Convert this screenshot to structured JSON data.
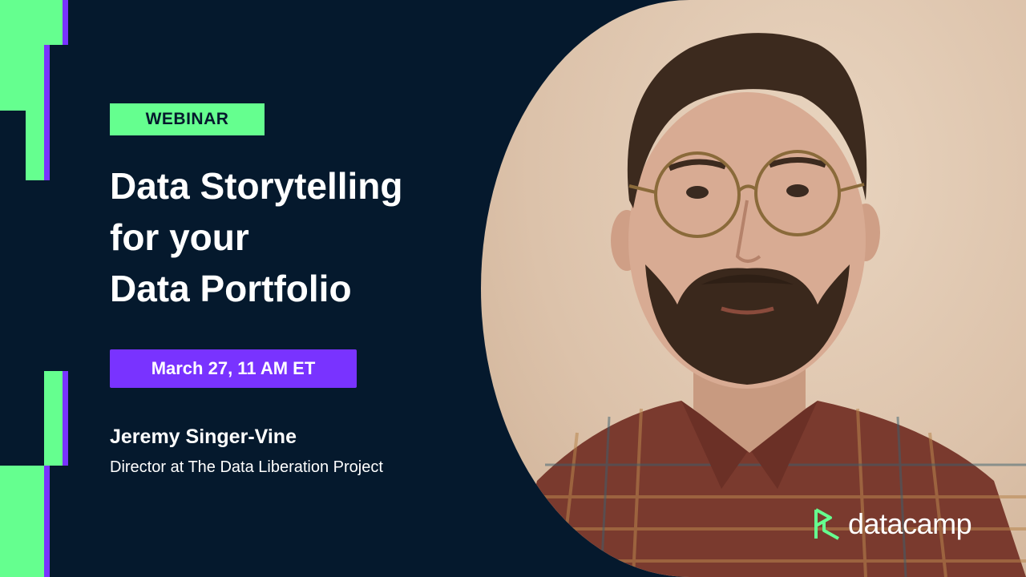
{
  "tag": "WEBINAR",
  "title_lines": [
    "Data Storytelling",
    "for your",
    "Data Portfolio"
  ],
  "date": "March 27, 11 AM ET",
  "speaker": {
    "name": "Jeremy Singer-Vine",
    "role": "Director at The Data Liberation Project"
  },
  "brand": {
    "name": "datacamp",
    "logo_icon": "datacamp-logo-icon"
  },
  "colors": {
    "background": "#05192d",
    "accent_green": "#65ff8f",
    "accent_purple": "#7933ff",
    "text": "#ffffff"
  }
}
